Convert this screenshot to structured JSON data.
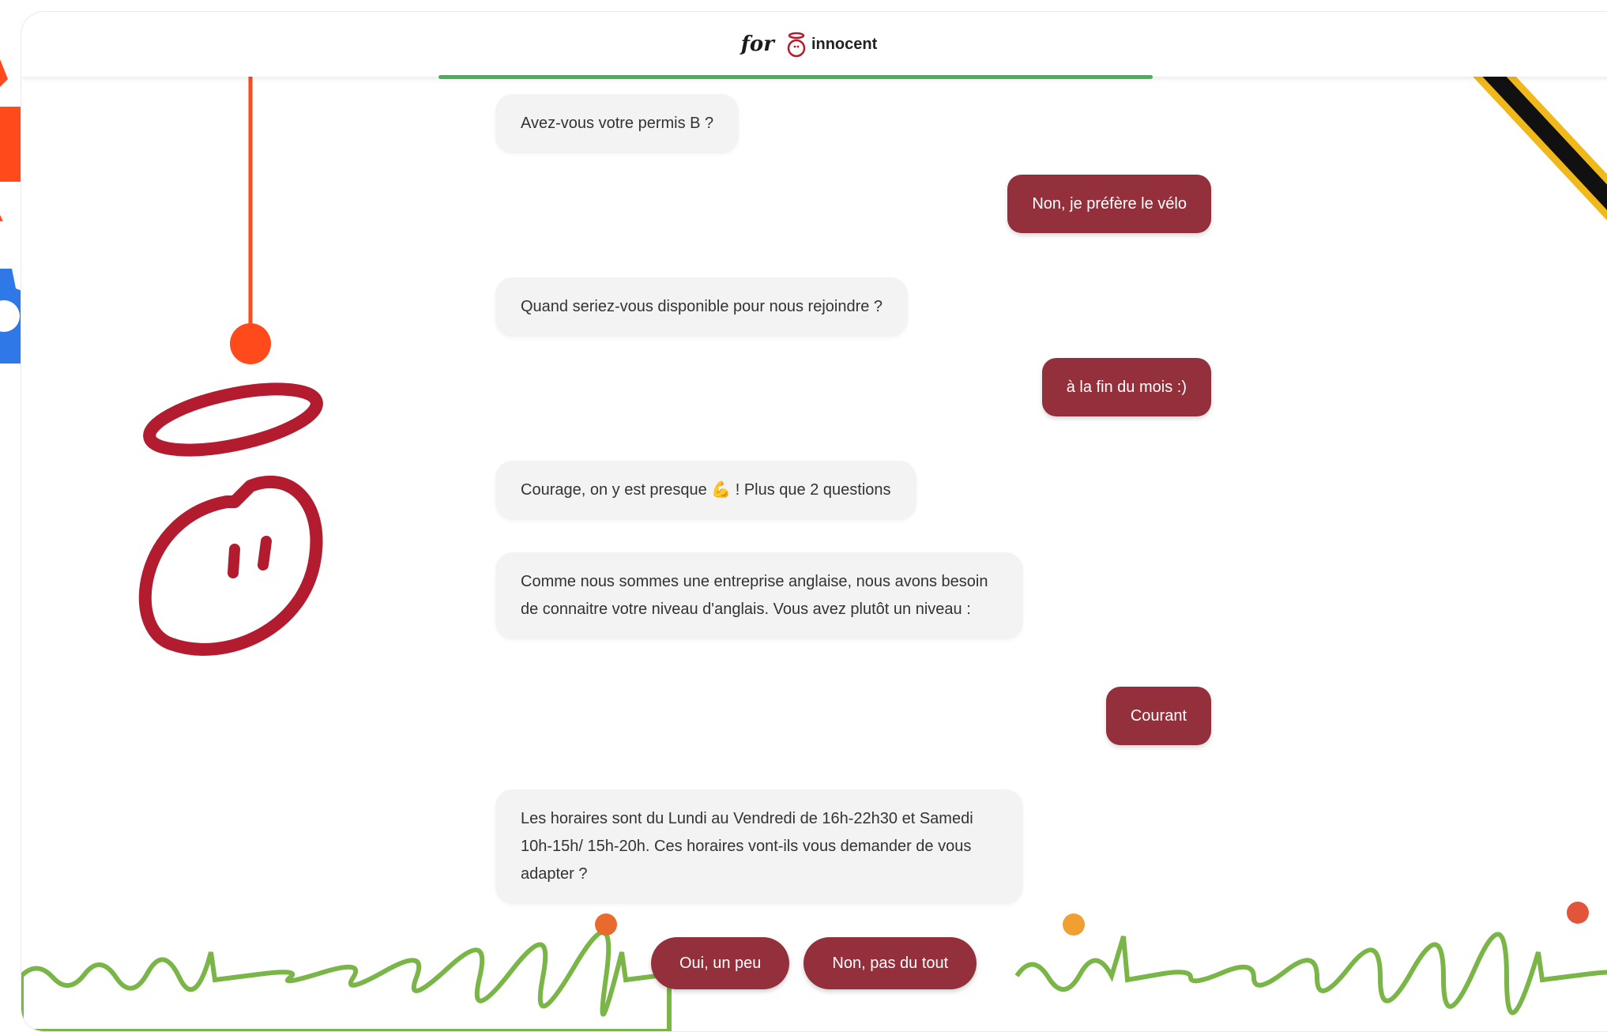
{
  "header": {
    "for_label": "for",
    "brand_name": "innocent"
  },
  "progress": {
    "fraction": 1.0,
    "color": "#4cae5a"
  },
  "colors": {
    "accent": "#93303b",
    "bot_bubble": "#f3f3f3",
    "grass": "#7ab548"
  },
  "messages": [
    {
      "from": "bot",
      "text": "Avez-vous votre permis B ?"
    },
    {
      "from": "user",
      "text": "Non, je préfère le vélo"
    },
    {
      "from": "bot",
      "text": "Quand seriez-vous disponible pour nous rejoindre ?"
    },
    {
      "from": "user",
      "text": "à la fin du mois :)"
    },
    {
      "from": "bot",
      "text": "Courage, on y est presque 💪 ! Plus que 2 questions"
    },
    {
      "from": "bot",
      "text": "Comme nous sommes une entreprise anglaise, nous avons besoin de connaitre votre niveau d'anglais. Vous avez plutôt un niveau :"
    },
    {
      "from": "user",
      "text": "Courant"
    },
    {
      "from": "bot",
      "text": "Les horaires sont du Lundi au Vendredi de 16h-22h30 et Samedi 10h-15h/ 15h-20h. Ces horaires vont-ils vous demander de vous adapter ?"
    }
  ],
  "answers": {
    "option_1": "Oui, un peu",
    "option_2": "Non, pas du tout"
  },
  "icons": [
    "innocent-logo-icon",
    "halo-mascot-icon",
    "gear-icon",
    "pencil-icon",
    "flower-icon"
  ]
}
